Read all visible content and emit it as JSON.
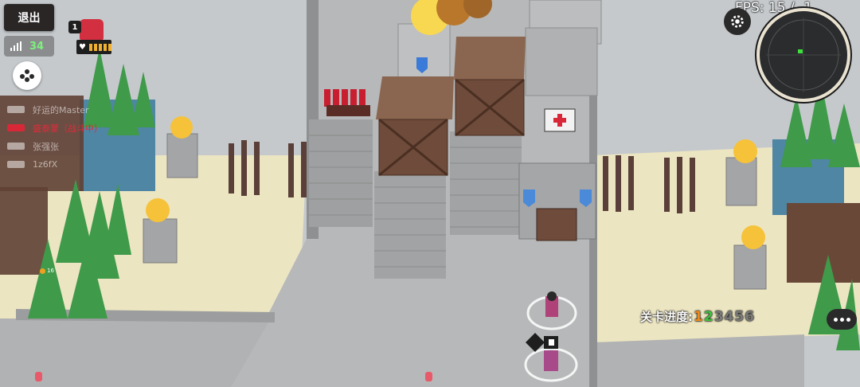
{
  "hud": {
    "exit_label": "退出",
    "ping": "34",
    "fps_label": "FPS: 15 / -1",
    "player_level": "1",
    "player_shield_badge": "+"
  },
  "players": [
    {
      "name": "好运的Master",
      "is_self": false
    },
    {
      "name": "盛泰蒙（战斗中）",
      "is_self": true
    },
    {
      "name": "张强张",
      "is_self": false
    },
    {
      "name": "1z6fX",
      "is_self": false
    }
  ],
  "level_progress": {
    "label": "关卡进度:",
    "stages": [
      {
        "num": "1",
        "color": "#f08a1c"
      },
      {
        "num": "2",
        "color": "#3ec13e"
      },
      {
        "num": "3",
        "color": "#7a7a7a"
      },
      {
        "num": "4",
        "color": "#7a7a7a"
      },
      {
        "num": "5",
        "color": "#7a7a7a"
      },
      {
        "num": "6",
        "color": "#7a7a7a"
      }
    ]
  },
  "scene": {
    "coin_count": "16",
    "colors": {
      "sand": "#ece5c2",
      "stone": "#b8b9ba",
      "wall": "#a6a7a8",
      "tree": "#3f9a4a",
      "water": "#4b7f9a",
      "wood": "#6e4b3a",
      "fire": "#f6c23a",
      "team_red": "#d8283a"
    }
  }
}
